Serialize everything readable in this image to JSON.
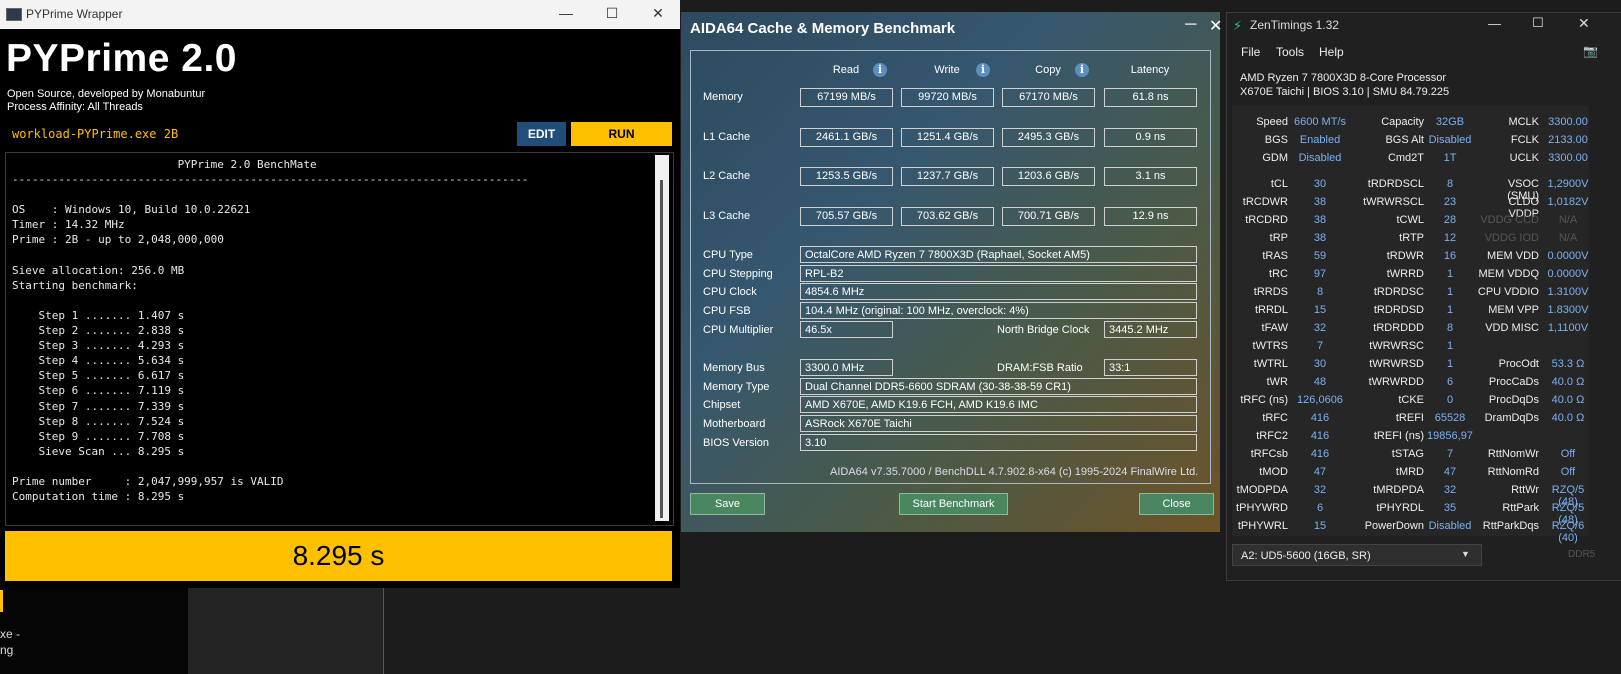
{
  "desktop": {
    "bg_text_1": "xe -",
    "bg_text_2": "ng"
  },
  "pyprime": {
    "window_title": "PYPrime Wrapper",
    "heading": "PYPrime 2.0",
    "subtitle_1": "Open Source, developed by Monabuntur",
    "subtitle_2": "Process Affinity: All Threads",
    "command": "workload-PYPrime.exe 2B",
    "edit_label": "EDIT",
    "run_label": "RUN",
    "console_lines": [
      "                         PYPrime 2.0 BenchMate",
      "------------------------------------------------------------------------------",
      "",
      "OS    : Windows 10, Build 10.0.22621",
      "Timer : 14.32 MHz",
      "Prime : 2B - up to 2,048,000,000",
      "",
      "Sieve allocation: 256.0 MB",
      "Starting benchmark:",
      "",
      "    Step 1 ....... 1.407 s",
      "    Step 2 ....... 2.838 s",
      "    Step 3 ....... 4.293 s",
      "    Step 4 ....... 5.634 s",
      "    Step 5 ....... 6.617 s",
      "    Step 6 ....... 7.119 s",
      "    Step 7 ....... 7.339 s",
      "    Step 8 ....... 7.524 s",
      "    Step 9 ....... 7.708 s",
      "    Sieve Scan ... 8.295 s",
      "",
      "Prime number     : 2,047,999,957 is VALID",
      "Computation time : 8.295 s"
    ],
    "result": "8.295 s",
    "accent_color": "#ffc000"
  },
  "aida": {
    "title": "AIDA64 Cache & Memory Benchmark",
    "columns": [
      "Read",
      "Write",
      "Copy",
      "Latency"
    ],
    "rows": [
      {
        "label": "Memory",
        "read": "67199 MB/s",
        "write": "99720 MB/s",
        "copy": "67170 MB/s",
        "latency": "61.8 ns"
      },
      {
        "label": "L1 Cache",
        "read": "2461.1 GB/s",
        "write": "1251.4 GB/s",
        "copy": "2495.3 GB/s",
        "latency": "0.9 ns"
      },
      {
        "label": "L2 Cache",
        "read": "1253.5 GB/s",
        "write": "1237.7 GB/s",
        "copy": "1203.6 GB/s",
        "latency": "3.1 ns"
      },
      {
        "label": "L3 Cache",
        "read": "705.57 GB/s",
        "write": "703.62 GB/s",
        "copy": "700.71 GB/s",
        "latency": "12.9 ns"
      }
    ],
    "cpu_type_label": "CPU Type",
    "cpu_type": "OctalCore AMD Ryzen 7 7800X3D  (Raphael, Socket AM5)",
    "cpu_stepping_label": "CPU Stepping",
    "cpu_stepping": "RPL-B2",
    "cpu_clock_label": "CPU Clock",
    "cpu_clock": "4854.6 MHz",
    "cpu_fsb_label": "CPU FSB",
    "cpu_fsb": "104.4 MHz  (original: 100 MHz, overclock: 4%)",
    "cpu_multiplier_label": "CPU Multiplier",
    "cpu_multiplier": "46.5x",
    "nb_clock_label": "North Bridge Clock",
    "nb_clock": "3445.2 MHz",
    "memory_bus_label": "Memory Bus",
    "memory_bus": "3300.0 MHz",
    "dram_ratio_label": "DRAM:FSB Ratio",
    "dram_ratio": "33:1",
    "memory_type_label": "Memory Type",
    "memory_type": "Dual Channel DDR5-6600 SDRAM  (30-38-38-59 CR1)",
    "chipset_label": "Chipset",
    "chipset": "AMD X670E, AMD K19.6 FCH, AMD K19.6 IMC",
    "motherboard_label": "Motherboard",
    "motherboard": "ASRock X670E Taichi",
    "bios_label": "BIOS Version",
    "bios": "3.10",
    "footer": "AIDA64 v7.35.7000 / BenchDLL 4.7.902.8-x64  (c) 1995-2024 FinalWire Ltd.",
    "save_label": "Save",
    "start_label": "Start Benchmark",
    "close_label": "Close"
  },
  "zen": {
    "title": "ZenTimings 1.32",
    "menu": [
      "File",
      "Tools",
      "Help"
    ],
    "cpu": "AMD Ryzen 7 7800X3D 8-Core Processor",
    "bios": "X670E Taichi | BIOS 3.10 | SMU 84.79.225",
    "rows": [
      [
        "Speed",
        "6600 MT/s",
        "Capacity",
        "32GB",
        "MCLK",
        "3300.00"
      ],
      [
        "BGS",
        "Enabled",
        "BGS Alt",
        "Disabled",
        "FCLK",
        "2133.00"
      ],
      [
        "GDM",
        "Disabled",
        "Cmd2T",
        "1T",
        "UCLK",
        "3300.00"
      ],
      [
        "tCL",
        "30",
        "tRDRDSCL",
        "8",
        "VSOC (SMU)",
        "1,2900V"
      ],
      [
        "tRCDWR",
        "38",
        "tWRWRSCL",
        "23",
        "CLDO VDDP",
        "1,0182V"
      ],
      [
        "tRCDRD",
        "38",
        "tCWL",
        "28",
        "VDDG CCD",
        "N/A"
      ],
      [
        "tRP",
        "38",
        "tRTP",
        "12",
        "VDDG IOD",
        "N/A"
      ],
      [
        "tRAS",
        "59",
        "tRDWR",
        "16",
        "MEM VDD",
        "0.0000V"
      ],
      [
        "tRC",
        "97",
        "tWRRD",
        "1",
        "MEM VDDQ",
        "0.0000V"
      ],
      [
        "tRRDS",
        "8",
        "tRDRDSC",
        "1",
        "CPU VDDIO",
        "1.3100V"
      ],
      [
        "tRRDL",
        "15",
        "tRDRDSD",
        "1",
        "MEM VPP",
        "1.8300V"
      ],
      [
        "tFAW",
        "32",
        "tRDRDDD",
        "8",
        "VDD MISC",
        "1,1100V"
      ],
      [
        "tWTRS",
        "7",
        "tWRWRSC",
        "1",
        "",
        ""
      ],
      [
        "tWTRL",
        "30",
        "tWRWRSD",
        "1",
        "ProcOdt",
        "53.3 Ω"
      ],
      [
        "tWR",
        "48",
        "tWRWRDD",
        "6",
        "ProcCaDs",
        "40.0 Ω"
      ],
      [
        "tRFC (ns)",
        "126,0606",
        "tCKE",
        "0",
        "ProcDqDs",
        "40.0 Ω"
      ],
      [
        "tRFC",
        "416",
        "tREFI",
        "65528",
        "DramDqDs",
        "40.0 Ω"
      ],
      [
        "tRFC2",
        "416",
        "tREFI (ns)",
        "19856,97",
        "",
        ""
      ],
      [
        "tRFCsb",
        "416",
        "tSTAG",
        "7",
        "RttNomWr",
        "Off"
      ],
      [
        "tMOD",
        "47",
        "tMRD",
        "47",
        "RttNomRd",
        "Off"
      ],
      [
        "tMODPDA",
        "32",
        "tMRDPDA",
        "32",
        "RttWr",
        "RZQ/5 (48)"
      ],
      [
        "tPHYWRD",
        "6",
        "tPHYRDL",
        "35",
        "RttPark",
        "RZQ/5 (48)"
      ],
      [
        "tPHYWRL",
        "15",
        "PowerDown",
        "Disabled",
        "RttParkDqs",
        "RZQ/6 (40)"
      ]
    ],
    "dim_labels": [
      "VDDG CCD",
      "VDDG IOD"
    ],
    "module_select": "A2: UD5-5600 (16GB, SR)",
    "ddr_label": "DDR5",
    "value_color": "#7ab0f5"
  }
}
